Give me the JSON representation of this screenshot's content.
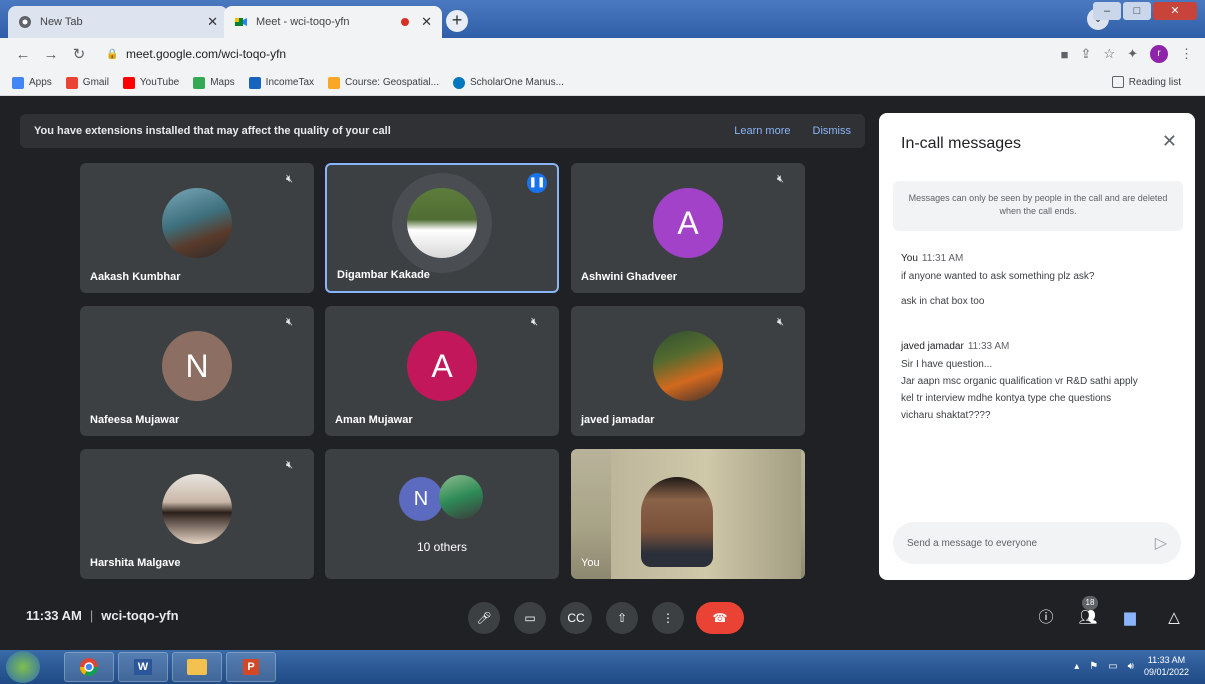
{
  "browser": {
    "tabs": [
      {
        "label": "New Tab"
      },
      {
        "label": "Meet - wci-toqo-yfn"
      }
    ],
    "url": "meet.google.com/wci-toqo-yfn",
    "profile_initial": "r",
    "bookmarks": [
      {
        "label": "Apps"
      },
      {
        "label": "Gmail"
      },
      {
        "label": "YouTube"
      },
      {
        "label": "Maps"
      },
      {
        "label": "IncomeTax"
      },
      {
        "label": "Course: Geospatial..."
      },
      {
        "label": "ScholarOne Manus..."
      }
    ],
    "reading_list": "Reading list"
  },
  "banner": {
    "text": "You have extensions installed that may affect the quality of your call",
    "learn_more": "Learn more",
    "dismiss": "Dismiss"
  },
  "participants": [
    {
      "name": "Aakash Kumbhar",
      "type": "photo"
    },
    {
      "name": "Digambar Kakade",
      "type": "photo",
      "speaking": true
    },
    {
      "name": "Ashwini Ghadveer",
      "type": "letter",
      "letter": "A",
      "color": "#a142c9"
    },
    {
      "name": "Nafeesa Mujawar",
      "type": "letter",
      "letter": "N",
      "color": "#8d6e63"
    },
    {
      "name": "Aman Mujawar",
      "type": "letter",
      "letter": "A",
      "color": "#c2185b"
    },
    {
      "name": "javed jamadar",
      "type": "photo"
    },
    {
      "name": "Harshita Malgave",
      "type": "photo"
    },
    {
      "name": "10 others",
      "type": "group",
      "letter": "N",
      "color": "#5c6bc0"
    },
    {
      "name": "You",
      "type": "video"
    }
  ],
  "chat": {
    "title": "In-call messages",
    "notice": "Messages can only be seen by people in the call and are deleted when the call ends.",
    "messages": [
      {
        "sender": "You",
        "time": "11:31 AM",
        "lines": [
          "if anyone wanted to ask something plz ask?",
          "ask in chat box too"
        ]
      },
      {
        "sender": "javed jamadar",
        "time": "11:33 AM",
        "lines": [
          "Sir I have question...",
          "Jar aapn msc organic qualification vr R&D sathi apply",
          "kel tr interview mdhe kontya type che questions",
          "vicharu shaktat????"
        ]
      }
    ],
    "input_placeholder": "Send a message to everyone"
  },
  "bottom_bar": {
    "time": "11:33 AM",
    "meeting_code": "wci-toqo-yfn",
    "people_count": "18"
  },
  "taskbar": {
    "time": "11:33 AM",
    "date": "09/01/2022"
  }
}
